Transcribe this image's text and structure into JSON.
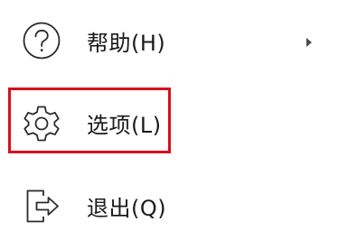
{
  "menu": {
    "items": [
      {
        "id": "help",
        "icon": "help-circle-icon",
        "label": "帮助(H)",
        "has_submenu": true
      },
      {
        "id": "options",
        "icon": "gear-icon",
        "label": "选项(L)",
        "has_submenu": false,
        "highlighted": true
      },
      {
        "id": "exit",
        "icon": "exit-icon",
        "label": "退出(Q)",
        "has_submenu": false
      }
    ]
  },
  "colors": {
    "highlight_border": "#d8101c",
    "text": "#1a1a1a",
    "icon_stroke": "#2b2b2b"
  }
}
